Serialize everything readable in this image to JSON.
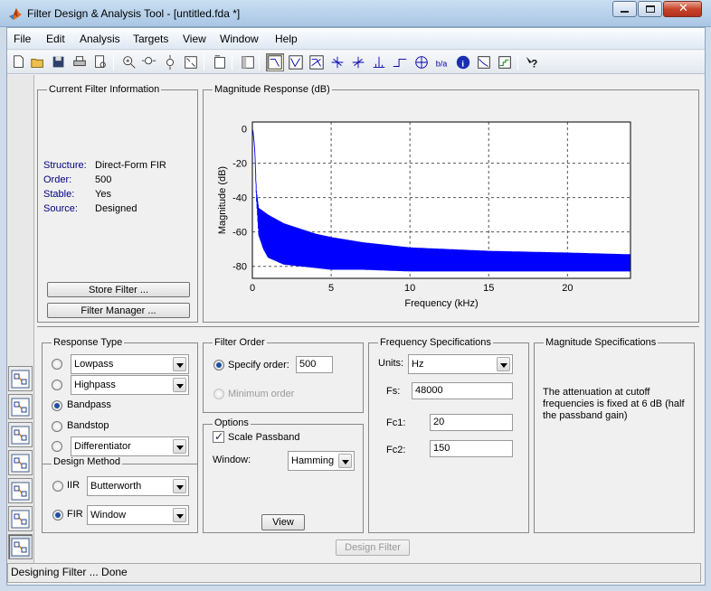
{
  "window": {
    "title": "Filter Design & Analysis Tool -  [untitled.fda *]"
  },
  "menu": [
    "File",
    "Edit",
    "Analysis",
    "Targets",
    "View",
    "Window",
    "Help"
  ],
  "toolbar": {
    "icons": [
      "new-icon",
      "open-icon",
      "save-icon",
      "print-icon",
      "print-preview-icon",
      "zoom-in-icon",
      "zoom-x-icon",
      "zoom-y-icon",
      "full-view-icon",
      "new-figure-icon",
      "sidebar-toggle-icon",
      "magnitude-response-icon",
      "phase-response-icon",
      "magnitude-phase-icon",
      "group-delay-icon",
      "phase-delay-icon",
      "impulse-response-icon",
      "step-response-icon",
      "pole-zero-icon",
      "filter-coefficients-icon",
      "filter-info-icon",
      "magnitude-estimate-icon",
      "noise-psd-icon",
      "whats-this-icon"
    ],
    "active": "magnitude-response-icon"
  },
  "current_filter": {
    "title": "Current Filter Information",
    "rows": [
      {
        "label": "Structure:",
        "value": "Direct-Form FIR"
      },
      {
        "label": "Order:",
        "value": "500"
      },
      {
        "label": "Stable:",
        "value": "Yes"
      },
      {
        "label": "Source:",
        "value": "Designed"
      }
    ],
    "store_button": "Store Filter ...",
    "manager_button": "Filter Manager ..."
  },
  "plot": {
    "title": "Magnitude Response (dB)"
  },
  "chart_data": {
    "type": "line",
    "xlabel": "Frequency (kHz)",
    "ylabel": "Magnitude (dB)",
    "xticks": [
      "0",
      "5",
      "10",
      "15",
      "20"
    ],
    "yticks": [
      "0",
      "-20",
      "-40",
      "-60",
      "-80"
    ],
    "xlim": [
      0,
      24
    ],
    "ylim": [
      -87,
      4
    ],
    "grid": true,
    "color": "#0000ff",
    "series": [
      {
        "x": [
          0,
          0.05,
          0.15,
          0.25,
          0.4,
          0.7,
          1,
          2,
          3,
          4,
          5,
          7,
          10,
          15,
          20,
          24
        ],
        "upper": [
          0,
          -2,
          -12,
          -35,
          -46,
          -48,
          -50,
          -55,
          -58,
          -61,
          -63,
          -66,
          -69,
          -71,
          -72,
          -73
        ],
        "lower": [
          0,
          -2,
          -12,
          -40,
          -62,
          -70,
          -75,
          -79,
          -80,
          -81,
          -82,
          -82,
          -83,
          -83,
          -83,
          -83
        ]
      }
    ]
  },
  "response_type": {
    "title": "Response Type",
    "options": [
      {
        "label": "Lowpass",
        "combo": true,
        "selected": false
      },
      {
        "label": "Highpass",
        "combo": true,
        "selected": false
      },
      {
        "label": "Bandpass",
        "combo": false,
        "selected": true
      },
      {
        "label": "Bandstop",
        "combo": false,
        "selected": false
      },
      {
        "label": "Differentiator",
        "combo": true,
        "selected": false
      }
    ]
  },
  "design_method": {
    "title": "Design Method",
    "iir_label": "IIR",
    "iir_value": "Butterworth",
    "fir_label": "FIR",
    "fir_value": "Window",
    "selected": "FIR"
  },
  "filter_order": {
    "title": "Filter Order",
    "specify_label": "Specify order:",
    "specify_value": "500",
    "minimum_label": "Minimum order"
  },
  "options": {
    "title": "Options",
    "scale_label": "Scale Passband",
    "scale_checked": true,
    "window_label": "Window:",
    "window_value": "Hamming",
    "view_button": "View"
  },
  "freq_specs": {
    "title": "Frequency Specifications",
    "units_label": "Units:",
    "units_value": "Hz",
    "fs_label": "Fs:",
    "fs_value": "48000",
    "fc1_label": "Fc1:",
    "fc1_value": "20",
    "fc2_label": "Fc2:",
    "fc2_value": "150"
  },
  "mag_specs": {
    "title": "Magnitude Specifications",
    "text": "The attenuation at cutoff frequencies is fixed at 6 dB (half the passband gain)"
  },
  "design_button": "Design Filter",
  "status": "Designing Filter ... Done"
}
